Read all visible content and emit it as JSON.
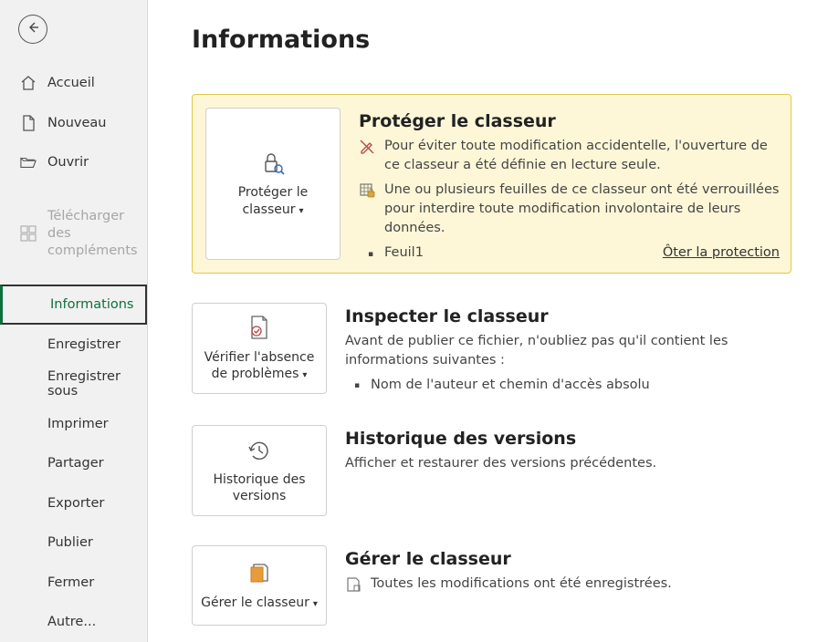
{
  "page_title": "Informations",
  "sidebar": {
    "items": [
      {
        "label": "Accueil",
        "icon": "home-icon"
      },
      {
        "label": "Nouveau",
        "icon": "new-doc-icon"
      },
      {
        "label": "Ouvrir",
        "icon": "folder-open-icon"
      }
    ],
    "addins": {
      "label": "Télécharger des compléments",
      "icon": "addins-icon"
    },
    "selected": {
      "label": "Informations"
    },
    "actions": [
      {
        "label": "Enregistrer"
      },
      {
        "label": "Enregistrer sous"
      },
      {
        "label": "Imprimer"
      },
      {
        "label": "Partager"
      },
      {
        "label": "Exporter"
      },
      {
        "label": "Publier"
      },
      {
        "label": "Fermer"
      },
      {
        "label": "Autre..."
      }
    ]
  },
  "protect": {
    "button_label": "Protéger le classeur",
    "title": "Protéger le classeur",
    "rows": [
      "Pour éviter toute modification accidentelle, l'ouverture de ce classeur a été définie en lecture seule.",
      "Une ou plusieurs feuilles de ce classeur ont été verrouillées pour interdire toute modification involontaire de leurs données."
    ],
    "sheet": "Feuil1",
    "unprotect_link": "Ôter la protection"
  },
  "inspect": {
    "button_label": "Vérifier l'absence de problèmes",
    "title": "Inspecter le classeur",
    "text": "Avant de publier ce fichier, n'oubliez pas qu'il contient les informations suivantes :",
    "bullets": [
      "Nom de l'auteur et chemin d'accès absolu"
    ]
  },
  "history": {
    "button_label": "Historique des versions",
    "title": "Historique des versions",
    "text": "Afficher et restaurer des versions précédentes."
  },
  "manage": {
    "button_label": "Gérer le classeur",
    "title": "Gérer le classeur",
    "text": "Toutes les modifications ont été enregistrées."
  }
}
